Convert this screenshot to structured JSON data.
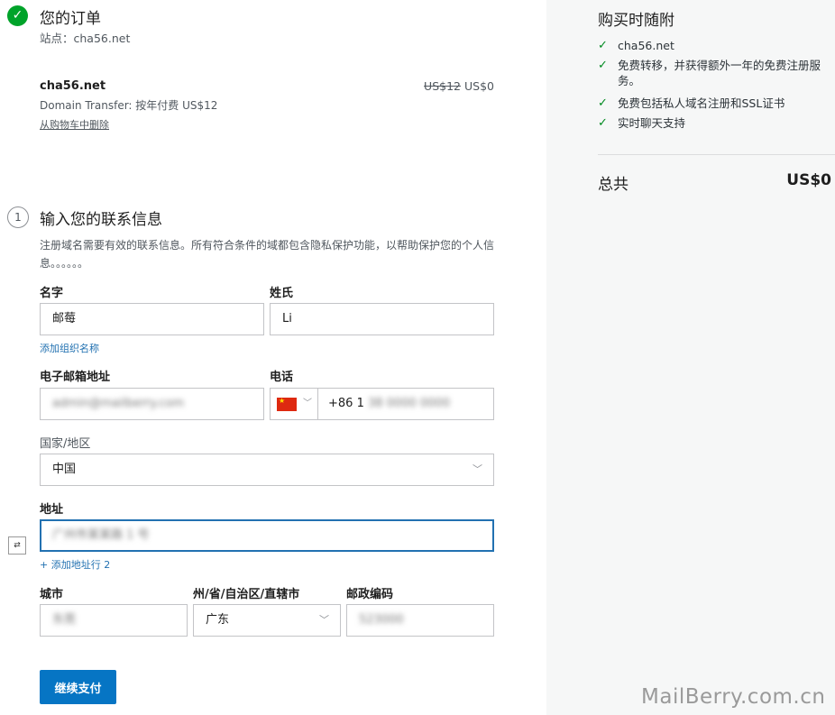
{
  "order": {
    "title": "您的订单",
    "site_label": "站点：cha56.net",
    "item": {
      "name": "cha56.net",
      "original_price": "US$12",
      "price": "US$0",
      "description": "Domain Transfer: 按年付费 US$12",
      "remove_label": "从购物车中删除"
    }
  },
  "contact": {
    "step_number": "1",
    "title": "输入您的联系信息",
    "description": "注册域名需要有效的联系信息。所有符合条件的域都包含隐私保护功能，以帮助保护您的个人信息。。。。。。",
    "first_name": {
      "label": "名字",
      "value": "邮莓"
    },
    "last_name": {
      "label": "姓氏",
      "value": "Li"
    },
    "add_org_link": "添加组织名称",
    "email": {
      "label": "电子邮箱地址",
      "value": "admin@mailberry.com"
    },
    "phone": {
      "label": "电话",
      "prefix": "+86 1",
      "value": "38 0000 0000"
    },
    "country": {
      "label": "国家/地区",
      "value": "中国"
    },
    "address": {
      "label": "地址",
      "value": "广州市某某路 1 号"
    },
    "add_address_line": "+ 添加地址行 2",
    "city": {
      "label": "城市",
      "value": "东莞"
    },
    "state": {
      "label": "州/省/自治区/直辖市",
      "value": "广东"
    },
    "postal": {
      "label": "邮政编码",
      "value": "523000"
    },
    "submit_label": "继续支付"
  },
  "summary": {
    "title": "购买时随附",
    "perks": [
      "cha56.net",
      "免费转移，并获得额外一年的免费注册服务。",
      "免费包括私人域名注册和SSL证书",
      "实时聊天支持"
    ],
    "total_label": "总共",
    "total_value": "US$0"
  },
  "watermark": "MailBerry.com.cn",
  "colors": {
    "accent": "#0675c4",
    "success": "#00a32a",
    "panel_bg": "#f6f7f7"
  },
  "icons": {
    "done": "checkmark-circle-icon",
    "perk": "checkmark-icon",
    "dropdown": "chevron-down-icon",
    "flag": "china-flag-icon"
  }
}
